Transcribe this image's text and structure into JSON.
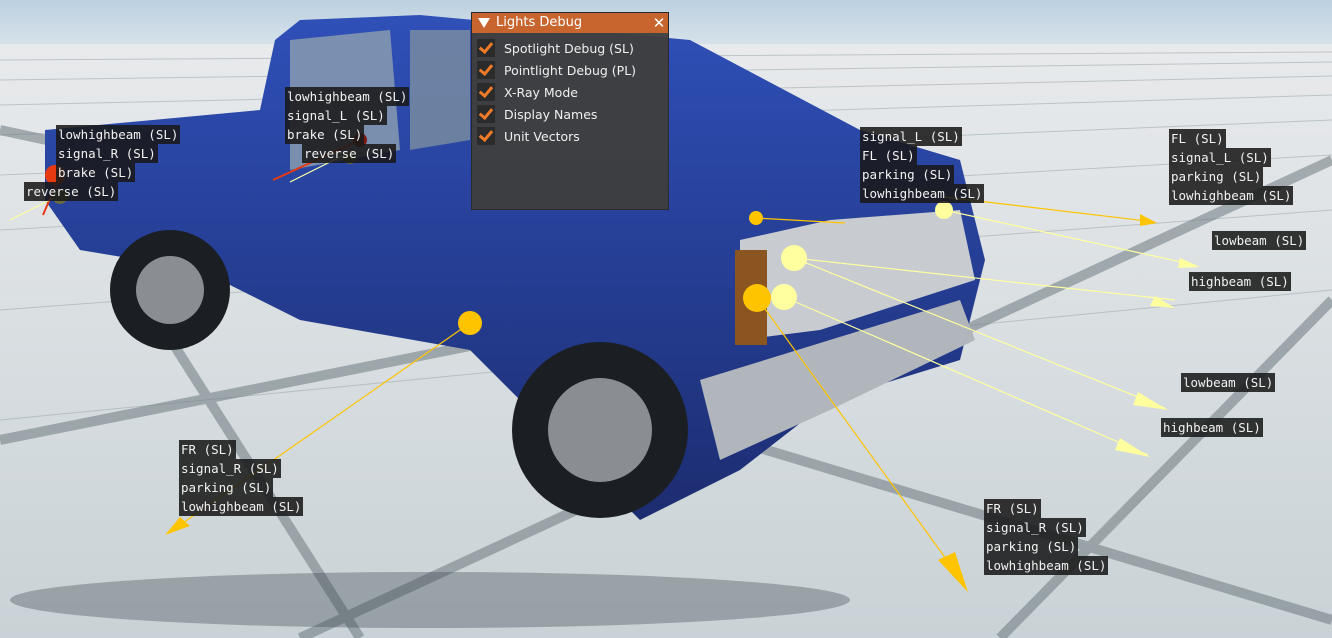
{
  "window": {
    "title": "Lights Debug",
    "collapse_icon": "triangle-down-icon",
    "close_icon": "close-icon",
    "options": [
      {
        "label": "Spotlight Debug (SL)",
        "checked": true
      },
      {
        "label": "Pointlight Debug (PL)",
        "checked": true
      },
      {
        "label": "X-Ray Mode",
        "checked": true
      },
      {
        "label": "Display Names",
        "checked": true
      },
      {
        "label": "Unit Vectors",
        "checked": true
      }
    ]
  },
  "colors": {
    "accent": "#c8652e",
    "check": "#f07a2a",
    "light_amber": "#ffc400",
    "light_pale": "#ffffa0",
    "light_red": "#e83a10",
    "vehicle_blue": "#2540a0"
  },
  "labels": {
    "rear_left": [
      "lowhighbeam (SL)",
      "signal_R (SL)",
      "brake (SL)",
      "reverse (SL)"
    ],
    "rear_right": [
      "lowhighbeam (SL)",
      "signal_L (SL)",
      "brake (SL)",
      "reverse (SL)"
    ],
    "front_left_lamp": [
      "signal_L (SL)",
      "FL (SL)",
      "parking (SL)",
      "lowhighbeam (SL)"
    ],
    "fl_target": [
      "FL (SL)",
      "signal_L (SL)",
      "parking (SL)",
      "lowhighbeam (SL)"
    ],
    "lowbeam_1": [
      "lowbeam (SL)"
    ],
    "highbeam_1": [
      "highbeam (SL)"
    ],
    "lowbeam_2": [
      "lowbeam (SL)"
    ],
    "highbeam_2": [
      "highbeam (SL)"
    ],
    "fr_side": [
      "FR (SL)",
      "signal_R (SL)",
      "parking (SL)",
      "lowhighbeam (SL)"
    ],
    "fr_front": [
      "FR (SL)",
      "signal_R (SL)",
      "parking (SL)",
      "lowhighbeam (SL)"
    ]
  }
}
